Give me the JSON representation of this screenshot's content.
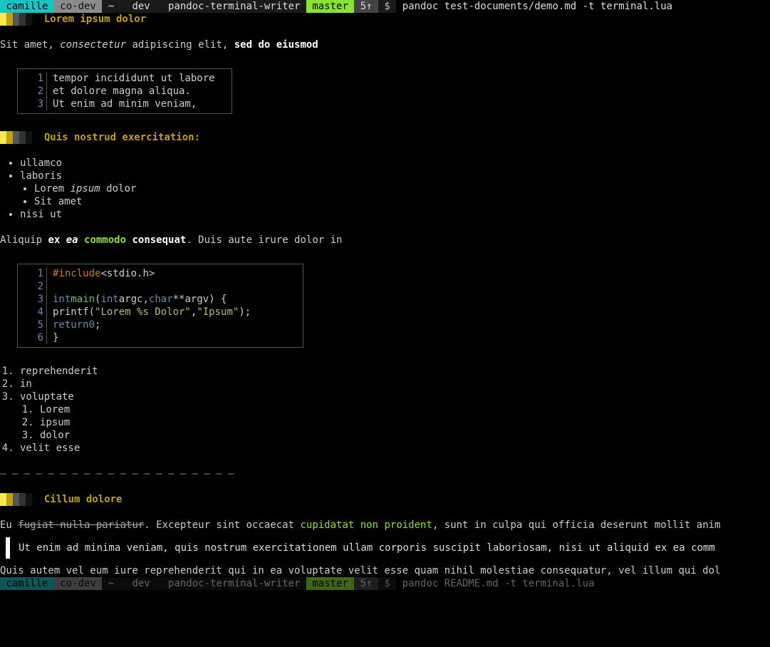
{
  "prompt": {
    "user": " camille ",
    "host": " co-dev ",
    "path": " ~   dev   pandoc-terminal-writer ",
    "branch": " master ",
    "status": " 5↑ ",
    "dollar": " $ ",
    "command1": "pandoc test-documents/demo.md -t terminal.lua",
    "command2": "pandoc README.md -t terminal.lua"
  },
  "h1": "Lorem ipsum dolor",
  "p1": {
    "a": "Sit amet, ",
    "b": "consectetur",
    "c": " adipiscing elit, ",
    "d": "sed do eiusmod"
  },
  "code1": {
    "lines": [
      "tempor incididunt ut labore",
      "et dolore magna aliqua.",
      "Ut enim ad minim veniam,"
    ],
    "nums": [
      "1",
      "2",
      "3"
    ]
  },
  "h2": "Quis nostrud exercitation:",
  "ul1": {
    "a": "ullamco",
    "b": "laboris",
    "c1": "Lorem ",
    "c2": "ipsum",
    "c3": " dolor",
    "d": "Sit amet",
    "e": "nisi ut"
  },
  "p2": {
    "a": "Aliquip ",
    "b": "ex ",
    "c": "ea",
    "d": " commodo",
    "e": " consequat",
    "f": ". Duis aute irure dolor in"
  },
  "code2": {
    "nums": [
      "1",
      "2",
      "3",
      "4",
      "5",
      "6"
    ],
    "inc": "#include",
    "hdr": " <stdio.h>",
    "int": "int",
    "main": " main",
    "lp": "(",
    "int2": "int",
    "argc": " argc, ",
    "char": "char",
    "argv": " **argv) {",
    "printf": "    printf(",
    "s1": "\"Lorem %s Dolor\"",
    "comma": ", ",
    "s2": "\"Ipsum\"",
    "end1": ");",
    "ret": "    return ",
    "zero": "0",
    "semi": ";",
    "close": "}"
  },
  "ol1": {
    "a": "reprehenderit",
    "b": "in",
    "c": "voluptate",
    "c1": "Lorem",
    "c2": "ipsum",
    "c3": "dolor",
    "d": "velit esse"
  },
  "hr": "— — — — — — — — — — — — — — — — — — — —",
  "h3": "Cillum dolore",
  "p3": {
    "a": "Eu ",
    "b": "fugiat nulla pariatur",
    "c": ". Excepteur sint occaecat ",
    "d": "cupidatat non proident",
    "e": ", sunt in culpa qui officia deserunt mollit anim"
  },
  "quote": "Ut enim ad minima veniam, quis nostrum exercitationem ullam corporis suscipit laboriosam, nisi ut aliquid ex ea comm",
  "p4": "Quis autem vel eum iure reprehenderit qui in ea voluptate velit esse quam nihil molestiae consequatur, vel illum qui dol"
}
